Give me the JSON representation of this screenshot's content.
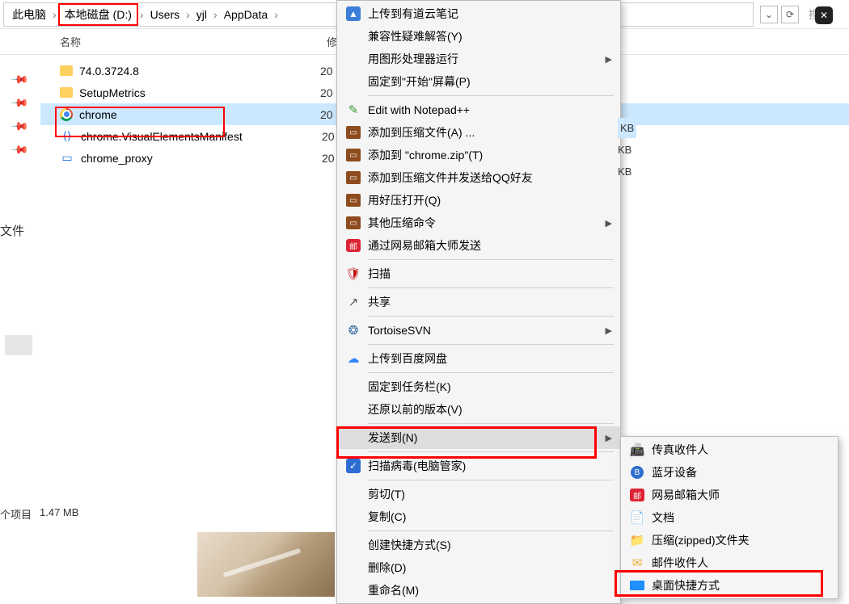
{
  "breadcrumb": {
    "items": [
      "此电脑",
      "本地磁盘 (D:)",
      "Users",
      "yjl",
      "AppData"
    ],
    "highlight_index": 1,
    "refresh_tip": "刷新",
    "search_placeholder": "搜索"
  },
  "columns": {
    "name": "名称",
    "modified": "修"
  },
  "files": [
    {
      "icon": "folder",
      "name": "74.0.3724.8",
      "mod": "20",
      "size": ""
    },
    {
      "icon": "folder",
      "name": "SetupMetrics",
      "mod": "20",
      "size": ""
    },
    {
      "icon": "chrome",
      "name": "chrome",
      "mod": "20",
      "size": "KB",
      "selected": true
    },
    {
      "icon": "xml",
      "name": "chrome.VisualElementsManifest",
      "mod": "20",
      "size": "KB"
    },
    {
      "icon": "exe",
      "name": "chrome_proxy",
      "mod": "20",
      "size": "KB"
    }
  ],
  "left_partial": "文件",
  "status": {
    "items_label": "个项目",
    "size": "1.47 MB"
  },
  "context_menu": [
    {
      "icon": "blue",
      "glyph": "▲",
      "label": "上传到有道云笔记",
      "sep": false
    },
    {
      "icon": "",
      "label": "兼容性疑难解答(Y)"
    },
    {
      "icon": "",
      "label": "用图形处理器运行",
      "arrow": true
    },
    {
      "icon": "",
      "label": "固定到\"开始\"屏幕(P)",
      "sep": true
    },
    {
      "icon": "green",
      "glyph": "✎",
      "label": "Edit with Notepad++"
    },
    {
      "icon": "arch",
      "glyph": "▭",
      "label": "添加到压缩文件(A) ..."
    },
    {
      "icon": "arch",
      "glyph": "▭",
      "label": "添加到 \"chrome.zip\"(T)"
    },
    {
      "icon": "arch",
      "glyph": "▭",
      "label": "添加到压缩文件并发送给QQ好友"
    },
    {
      "icon": "arch",
      "glyph": "▭",
      "label": "用好压打开(Q)"
    },
    {
      "icon": "arch",
      "glyph": "▭",
      "label": "其他压缩命令",
      "arrow": true
    },
    {
      "icon": "red",
      "glyph": "邮",
      "label": "通过网易邮箱大师发送",
      "sep": true
    },
    {
      "icon": "mcafee",
      "glyph": "🛡",
      "label": "扫描",
      "sep": true
    },
    {
      "icon": "share",
      "glyph": "↗",
      "label": "共享",
      "sep": true
    },
    {
      "icon": "svn",
      "glyph": "❂",
      "label": "TortoiseSVN",
      "arrow": true,
      "sep": true
    },
    {
      "icon": "baidu",
      "glyph": "☁",
      "label": "上传到百度网盘",
      "sep": true
    },
    {
      "icon": "",
      "label": "固定到任务栏(K)"
    },
    {
      "icon": "",
      "label": "还原以前的版本(V)",
      "sep": true
    },
    {
      "icon": "",
      "label": "发送到(N)",
      "arrow": true,
      "hov": true,
      "sep": true
    },
    {
      "icon": "shield",
      "glyph": "✓",
      "label": "扫描病毒(电脑管家)",
      "sep": true
    },
    {
      "icon": "",
      "label": "剪切(T)"
    },
    {
      "icon": "",
      "label": "复制(C)",
      "sep": true
    },
    {
      "icon": "",
      "label": "创建快捷方式(S)"
    },
    {
      "icon": "",
      "label": "删除(D)"
    },
    {
      "icon": "",
      "label": "重命名(M)"
    }
  ],
  "submenu": [
    {
      "icon": "fax",
      "glyph": "📠",
      "label": "传真收件人"
    },
    {
      "icon": "bt",
      "glyph": "B",
      "label": "蓝牙设备"
    },
    {
      "icon": "163",
      "glyph": "邮",
      "label": "网易邮箱大师"
    },
    {
      "icon": "doc",
      "glyph": "📄",
      "label": "文档"
    },
    {
      "icon": "zip",
      "glyph": "📁",
      "label": "压缩(zipped)文件夹"
    },
    {
      "icon": "mail",
      "glyph": "✉",
      "label": "邮件收件人"
    },
    {
      "icon": "desk",
      "glyph": "",
      "label": "桌面快捷方式"
    }
  ]
}
